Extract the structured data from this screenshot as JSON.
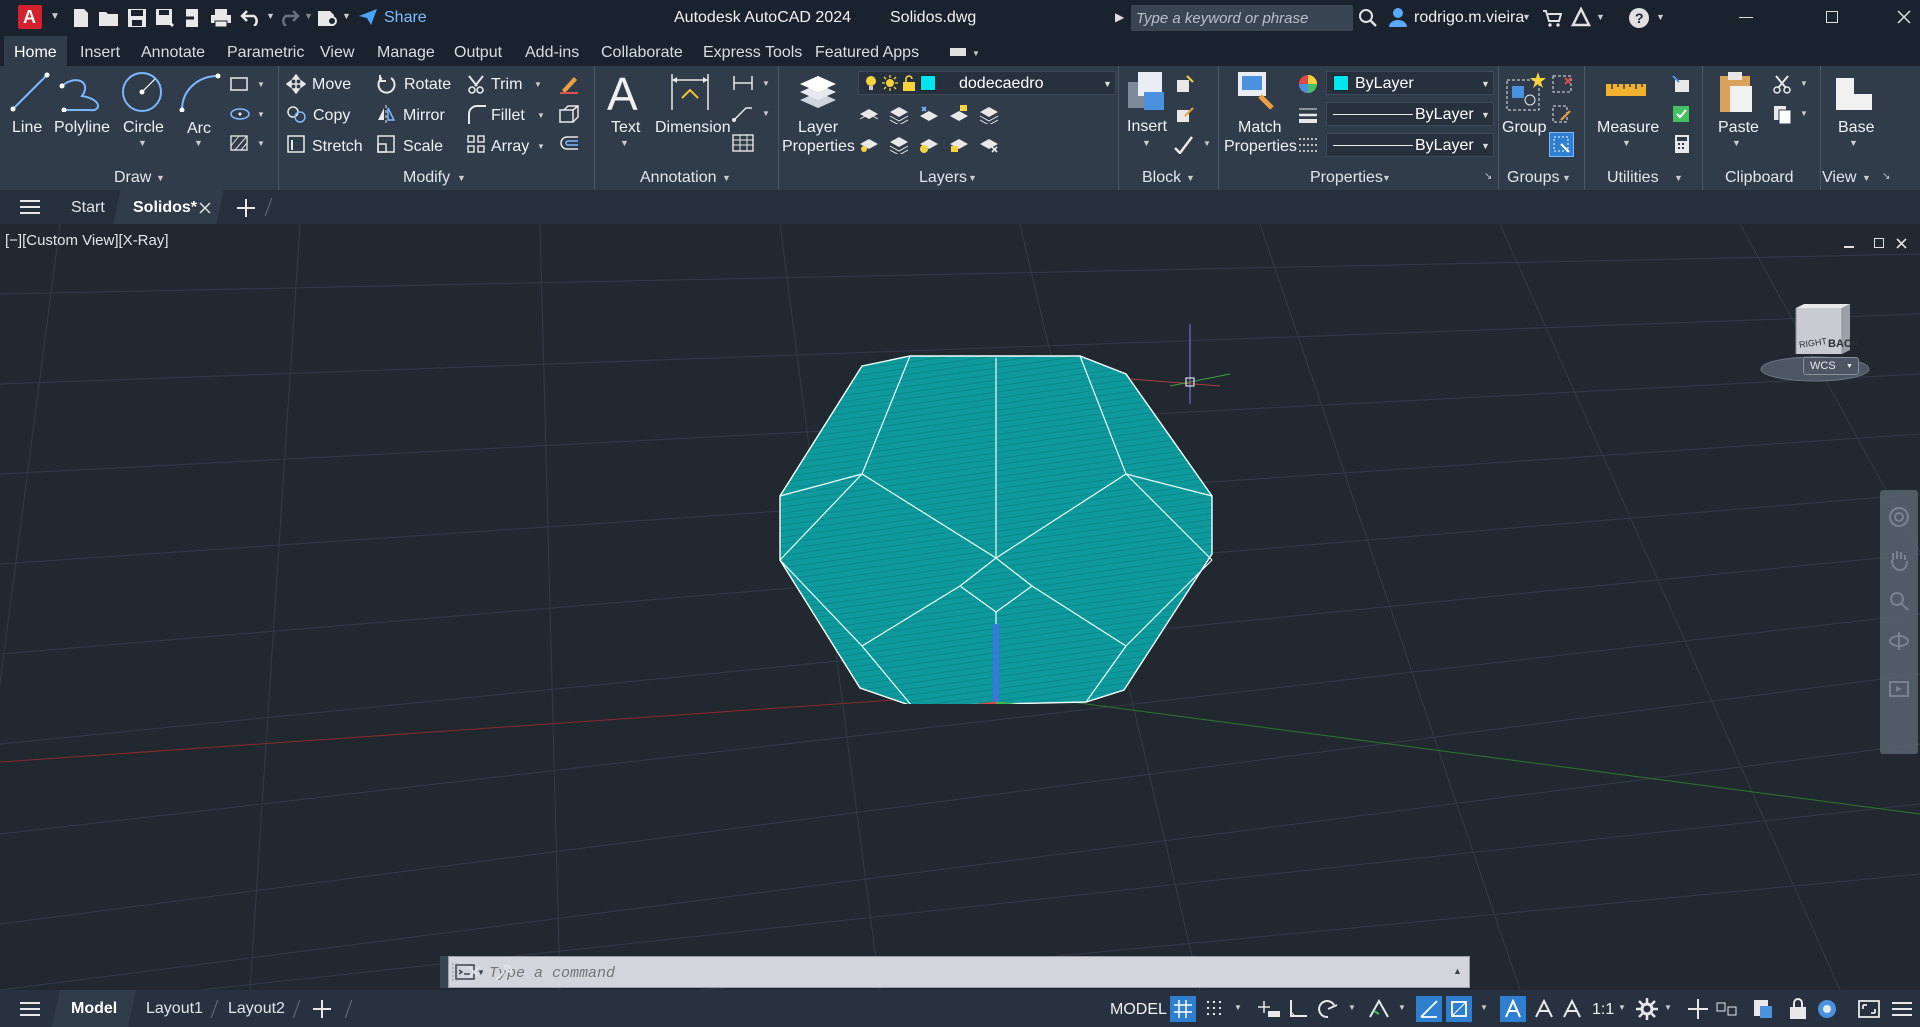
{
  "titlebar": {
    "app_title": "Autodesk AutoCAD 2024",
    "file_name": "Solidos.dwg",
    "share_label": "Share",
    "search_placeholder": "Type a keyword or phrase",
    "user_name": "rodrigo.m.vieira",
    "app_letter": "A"
  },
  "ribbon_tabs": [
    "Home",
    "Insert",
    "Annotate",
    "Parametric",
    "View",
    "Manage",
    "Output",
    "Add-ins",
    "Collaborate",
    "Express Tools",
    "Featured Apps"
  ],
  "draw": {
    "line": "Line",
    "polyline": "Polyline",
    "circle": "Circle",
    "arc": "Arc",
    "panel": "Draw"
  },
  "modify": {
    "move": "Move",
    "rotate": "Rotate",
    "trim": "Trim",
    "copy": "Copy",
    "mirror": "Mirror",
    "fillet": "Fillet",
    "stretch": "Stretch",
    "scale": "Scale",
    "array": "Array",
    "panel": "Modify"
  },
  "annotation": {
    "text": "Text",
    "dimension": "Dimension",
    "panel": "Annotation"
  },
  "layers": {
    "layer_properties_1": "Layer",
    "layer_properties_2": "Properties",
    "current_layer": "dodecaedro",
    "panel": "Layers"
  },
  "block": {
    "insert": "Insert",
    "panel": "Block"
  },
  "properties": {
    "match_1": "Match",
    "match_2": "Properties",
    "color": "ByLayer",
    "linetype": "ByLayer",
    "lineweight": "ByLayer",
    "panel": "Properties"
  },
  "groups": {
    "group": "Group",
    "panel": "Groups"
  },
  "utilities": {
    "measure": "Measure",
    "panel": "Utilities"
  },
  "clipboard": {
    "paste": "Paste",
    "panel": "Clipboard"
  },
  "view": {
    "base": "Base",
    "panel": "View"
  },
  "file_tabs": {
    "start": "Start",
    "current": "Solidos*"
  },
  "viewport": {
    "label": "[−][Custom View][X-Ray]",
    "viewcube_right": "RIGHT",
    "viewcube_back": "BACK",
    "wcs": "WCS"
  },
  "command": {
    "placeholder": "Type a command"
  },
  "status": {
    "layout_tabs": [
      "Model",
      "Layout1",
      "Layout2"
    ],
    "model": "MODEL",
    "scale": "1:1"
  },
  "colors": {
    "accent": "#00e5ee",
    "solid_fill": "#0d9a9c",
    "highlight": "#2e8de0"
  }
}
